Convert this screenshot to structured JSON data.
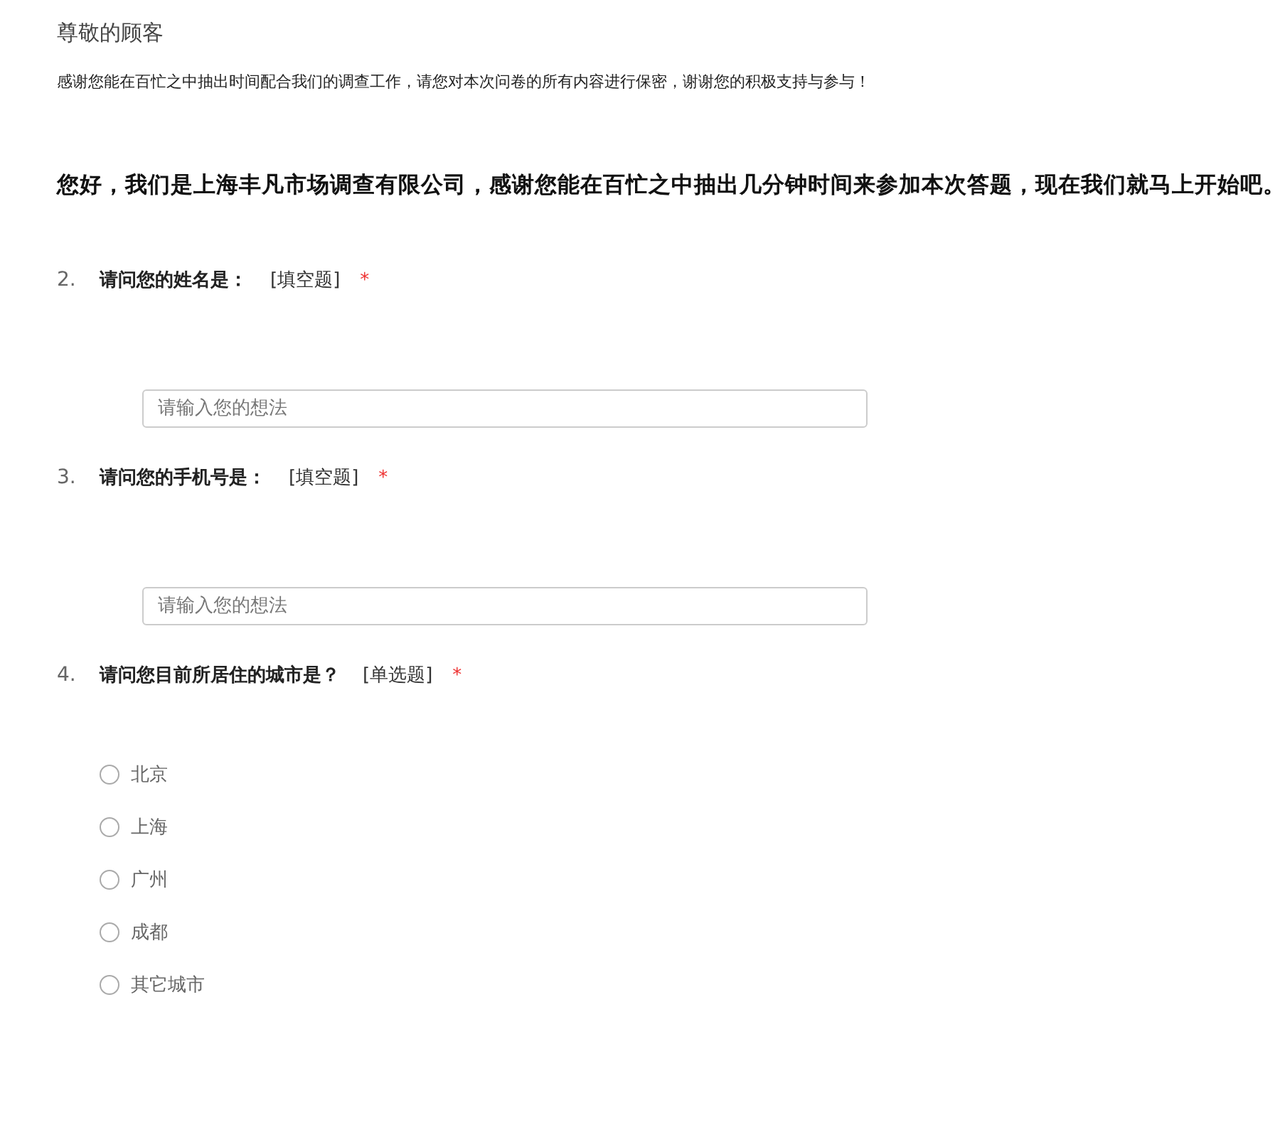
{
  "greeting": "尊敬的顾客",
  "intro": "感谢您能在百忙之中抽出时间配合我们的调查工作，请您对本次问卷的所有内容进行保密，谢谢您的积极支持与参与！",
  "heading": "您好，我们是上海丰凡市场调查有限公司，感谢您能在百忙之中抽出几分钟时间来参加本次答题，现在我们就马上开始吧。",
  "questions": [
    {
      "number": "2.",
      "title": "请问您的姓名是：",
      "type_label": "[填空题]",
      "required_mark": "*",
      "kind": "text",
      "placeholder": "请输入您的想法"
    },
    {
      "number": "3.",
      "title": "请问您的手机号是：",
      "type_label": "[填空题]",
      "required_mark": "*",
      "kind": "text",
      "placeholder": "请输入您的想法"
    },
    {
      "number": "4.",
      "title": "请问您目前所居住的城市是？",
      "type_label": "[单选题]",
      "required_mark": "*",
      "kind": "radio",
      "options": [
        {
          "label": "北京",
          "selected": false
        },
        {
          "label": "上海",
          "selected": false
        },
        {
          "label": "广州",
          "selected": false
        },
        {
          "label": "成都",
          "selected": false
        },
        {
          "label": "其它城市",
          "selected": false
        }
      ]
    }
  ]
}
